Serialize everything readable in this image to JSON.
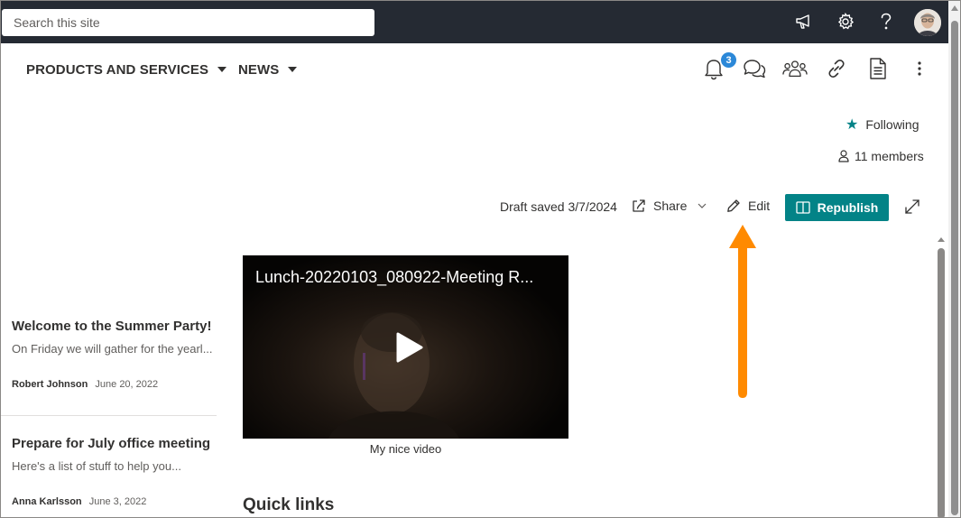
{
  "search": {
    "placeholder": "Search this site"
  },
  "suite_icons": [
    "megaphone-icon",
    "gear-icon",
    "help-icon"
  ],
  "nav": {
    "items": [
      {
        "label": "PRODUCTS AND SERVICES"
      },
      {
        "label": "NEWS"
      }
    ]
  },
  "toolbar": {
    "notification_count": "3",
    "icons": [
      "bell-icon",
      "chat-icon",
      "people-icon",
      "link-icon",
      "document-icon",
      "more-icon"
    ]
  },
  "site": {
    "following_label": "Following",
    "members_label": "11 members"
  },
  "commandbar": {
    "draft_status": "Draft saved 3/7/2024",
    "share_label": "Share",
    "edit_label": "Edit",
    "republish_label": "Republish"
  },
  "colors": {
    "suitebar": "#252a33",
    "accent": "#038387",
    "badge": "#2b88d8",
    "annotation_arrow": "#ff8a00"
  },
  "news": [
    {
      "title": "Welcome to the Summer Party!",
      "description": "On Friday we will gather for the yearl...",
      "author": "Robert Johnson",
      "date": "June 20, 2022"
    },
    {
      "title": "Prepare for July office meeting",
      "description": "Here's a list of stuff to help you...",
      "author": "Anna Karlsson",
      "date": "June 3, 2022"
    }
  ],
  "video": {
    "title": "Lunch-20220103_080922-Meeting R...",
    "caption": "My nice video"
  },
  "quick_links": {
    "heading": "Quick links"
  }
}
